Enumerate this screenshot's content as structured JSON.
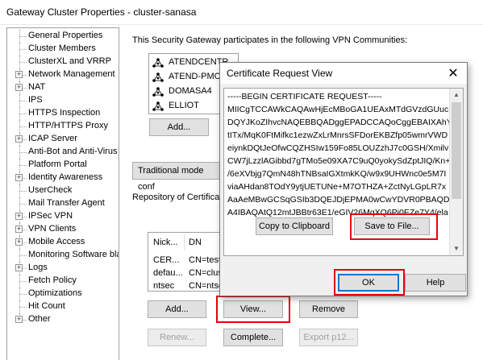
{
  "window": {
    "title": "Gateway Cluster Properties - cluster-sanasa"
  },
  "tree": {
    "items": [
      {
        "label": "General Properties",
        "expandable": false
      },
      {
        "label": "Cluster Members",
        "expandable": false
      },
      {
        "label": "ClusterXL and VRRP",
        "expandable": false
      },
      {
        "label": "Network Management",
        "expandable": true
      },
      {
        "label": "NAT",
        "expandable": true
      },
      {
        "label": "IPS",
        "expandable": false
      },
      {
        "label": "HTTPS Inspection",
        "expandable": false
      },
      {
        "label": "HTTP/HTTPS Proxy",
        "expandable": false
      },
      {
        "label": "ICAP Server",
        "expandable": true
      },
      {
        "label": "Anti-Bot and Anti-Virus",
        "expandable": false
      },
      {
        "label": "Platform Portal",
        "expandable": false
      },
      {
        "label": "Identity Awareness",
        "expandable": true
      },
      {
        "label": "UserCheck",
        "expandable": false
      },
      {
        "label": "Mail Transfer Agent",
        "expandable": false
      },
      {
        "label": "IPSec VPN",
        "expandable": true,
        "selected": true
      },
      {
        "label": "VPN Clients",
        "expandable": true
      },
      {
        "label": "Mobile Access",
        "expandable": true
      },
      {
        "label": "Monitoring Software bla",
        "expandable": false
      },
      {
        "label": "Logs",
        "expandable": true
      },
      {
        "label": "Fetch Policy",
        "expandable": false
      },
      {
        "label": "Optimizations",
        "expandable": false
      },
      {
        "label": "Hit Count",
        "expandable": false
      },
      {
        "label": "Other",
        "expandable": true
      }
    ]
  },
  "vpn": {
    "communities_label": "This Security Gateway participates in the following VPN Communities:",
    "communities": [
      "ATENDCENTR",
      "ATEND-PMC",
      "DOMASA4",
      "ELLIOT"
    ],
    "add_label": "Add...",
    "traditional_label": "Traditional mode conf",
    "repository_label": "Repository of Certificate",
    "table_headers": [
      "Nick...",
      "DN"
    ],
    "table_rows": [
      [
        "CER...",
        "CN=test"
      ],
      [
        "defau...",
        "CN=clus"
      ],
      [
        "ntsec",
        "CN=ntse"
      ]
    ],
    "cert_add_label": "Add...",
    "view_label": "View...",
    "remove_label": "Remove",
    "renew_label": "Renew...",
    "complete_label": "Complete...",
    "export_label": "Export p12..."
  },
  "dialog": {
    "title": "Certificate Request View",
    "close_glyph": "✕",
    "cert_lines": [
      "-----BEGIN CERTIFICATE REQUEST-----",
      "MIICgTCCAWkCAQAwHjEcMBoGA1UEAxMTdGVzdGUuc",
      "DQYJKoZIhvcNAQEBBQADggEPADCCAQoCggEBAIXAhY",
      "tITx/MqK0FtMifkc1ezwZxLrMnrsSFDorEKBZfp05wmrVWD",
      "eiynkDQtJeOfwCQZHSIw159Fo85LOUZzhJ7c0GSH/Xmilv",
      "CW7jLzzlAGibbd7gTMo5e09XA7C9uQ0yokySdZptJIQ/Kn+",
      "/6eXVbjg7QmN48hTNBsaIGXtmkKQ/w9x9UHWnc0e5M7I",
      "viaAHdan8TOdY9ytjUETUNe+M7OTHZA+ZctNyLGpLR7x",
      "AaAeMBwGCSqGSIb3DQEJDjEPMA0wCwYDVR0PBAQDA",
      "A4IBAQAtQ12mtJBBtr63E1/eGIV26MqXQ6Pi0EZe7Y4/ela"
    ],
    "copy_label": "Copy to Clipboard",
    "save_label": "Save to File...",
    "ok_label": "OK",
    "help_label": "Help"
  },
  "colors": {
    "highlight_red": "#e8000f",
    "ok_border": "#0078d7"
  }
}
